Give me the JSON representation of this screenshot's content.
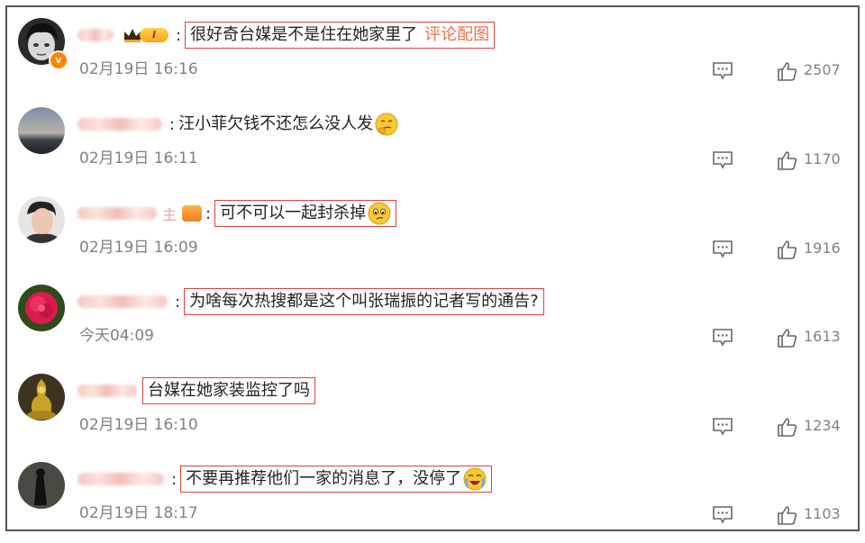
{
  "comments": [
    {
      "text": "很好奇台媒是不是住在她家里了",
      "link": "评论配图",
      "time": "02月19日 16:16",
      "likes": "2507",
      "vip_level": "I",
      "verified": "v"
    },
    {
      "text": "汪小菲欠钱不还怎么没人发",
      "time": "02月19日 16:11",
      "likes": "1170"
    },
    {
      "name_suffix": "主",
      "text": "可不可以一起封杀掉",
      "time": "02月19日 16:09",
      "likes": "1916"
    },
    {
      "text": "为啥每次热搜都是这个叫张瑞振的记者写的通告?",
      "time": "今天04:09",
      "likes": "1613"
    },
    {
      "text": "台媒在她家装监控了吗",
      "time": "02月19日 16:10",
      "likes": "1234"
    },
    {
      "text": "不要再推荐他们一家的消息了，没停了",
      "time": "02月19日 18:17",
      "likes": "1103"
    }
  ],
  "colors": {
    "highlight_border": "#e0403a",
    "link": "#eb7350",
    "timestamp": "#808080",
    "verified_badge": "#ff8200"
  },
  "icons": [
    "reply-icon",
    "like-icon",
    "crown-icon",
    "emoji-thinking",
    "emoji-smirk",
    "emoji-laugh-cry"
  ]
}
